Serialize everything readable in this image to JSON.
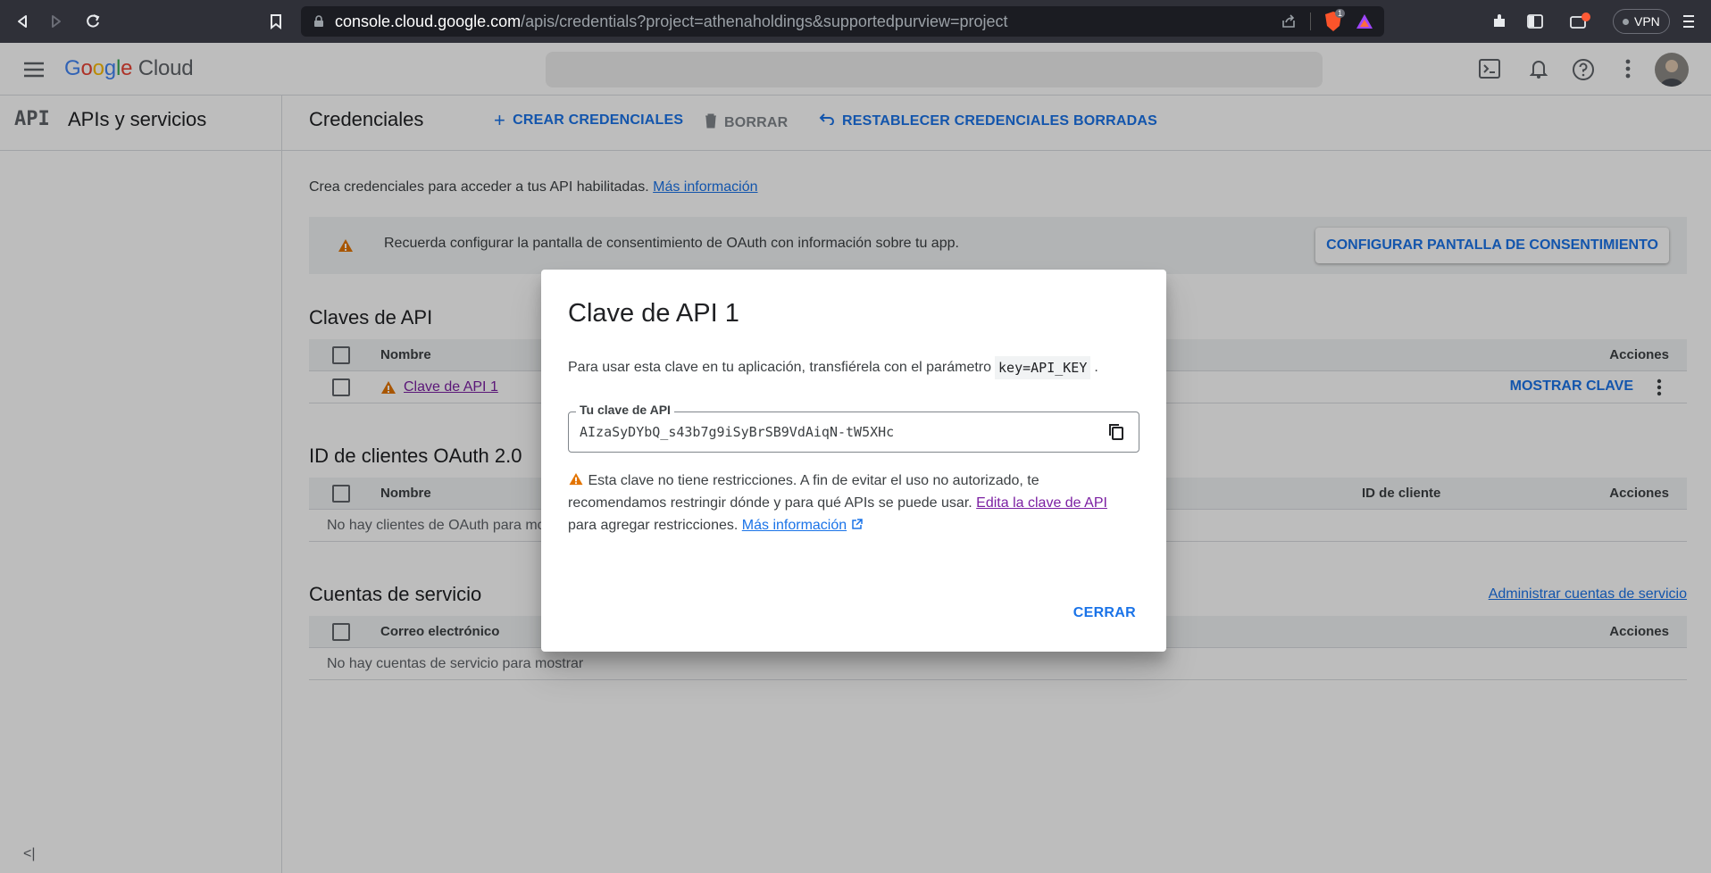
{
  "browser": {
    "url_host": "console.cloud.google.com",
    "url_path": "/apis/credentials?project=athenaholdings&supportedpurview=project",
    "brave_badge": "1",
    "vpn_label": "VPN"
  },
  "app": {
    "logo_google": [
      "G",
      "o",
      "o",
      "g",
      "l",
      "e"
    ],
    "logo_cloud": "Cloud",
    "sidebar_title": "APIs y servicios",
    "api_badge": "API",
    "collapse_label": "<|"
  },
  "page": {
    "title": "Credenciales",
    "actions": {
      "create": "CREAR CREDENCIALES",
      "delete": "BORRAR",
      "restore": "RESTABLECER CREDENCIALES BORRADAS"
    },
    "intro_text": "Crea credenciales para acceder a tus API habilitadas.",
    "intro_link": "Más información",
    "banner_text": "Recuerda configurar la pantalla de consentimiento de OAuth con información sobre tu app.",
    "banner_button": "CONFIGURAR PANTALLA DE CONSENTIMIENTO"
  },
  "api_keys": {
    "title": "Claves de API",
    "col_name": "Nombre",
    "col_actions": "Acciones",
    "row_name": "Clave de API 1",
    "row_action": "MOSTRAR CLAVE"
  },
  "oauth": {
    "title": "ID de clientes OAuth 2.0",
    "col_name": "Nombre",
    "col_client_id": "ID de cliente",
    "col_actions": "Acciones",
    "empty": "No hay clientes de OAuth para mo"
  },
  "service_accounts": {
    "title": "Cuentas de servicio",
    "manage_link": "Administrar cuentas de servicio",
    "col_email": "Correo electrónico",
    "col_actions": "Acciones",
    "empty": "No hay cuentas de servicio para mostrar"
  },
  "dialog": {
    "title": "Clave de API 1",
    "desc_before": "Para usar esta clave en tu aplicación, transfiérela con el parámetro",
    "desc_code": "key=API_KEY",
    "desc_after": ".",
    "field_label": "Tu clave de API",
    "field_value": "AIzaSyDYbQ_s43b7g9iSyBrSB9VdAiqN-tW5XHc",
    "warning_text": "Esta clave no tiene restricciones. A fin de evitar el uso no autorizado, te recomendamos restringir dónde y para qué APIs se puede usar.",
    "edit_link": "Edita la clave de API",
    "warning_after": "para agregar restricciones.",
    "more_link": "Más información",
    "close_button": "CERRAR"
  },
  "colors": {
    "accent": "#1a73e8",
    "warning": "#e37400",
    "chrome_bg": "#2f3038"
  }
}
